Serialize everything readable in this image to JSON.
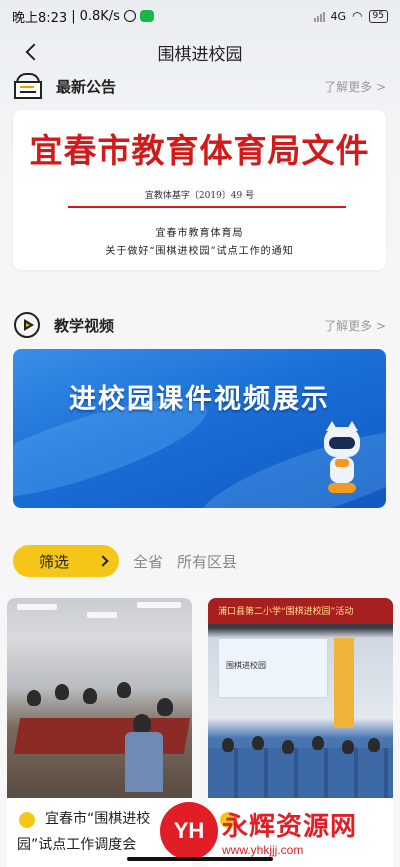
{
  "status_bar": {
    "time": "晚上8:23",
    "speed": "0.8K/s",
    "network": "4G",
    "battery": "95"
  },
  "nav": {
    "title": "围棋进校园"
  },
  "announcements": {
    "title": "最新公告",
    "more": "了解更多 >",
    "doc_header": "宜春市教育体育局文件",
    "doc_number": "宜教体基字〔2019〕49 号",
    "doc_line_1": "宜春市教育体育局",
    "doc_line_2": "关于做好“围棋进校园”试点工作的通知"
  },
  "videos": {
    "title": "教学视频",
    "more": "了解更多 >",
    "banner_text": "进校园课件视频展示"
  },
  "filter": {
    "button_label": "筛选",
    "option_province": "全省",
    "option_counties": "所有区县"
  },
  "cards": [
    {
      "title_line_1": "宜春市“围棋进校",
      "title_line_2": "园”试点工作调度会"
    },
    {
      "title_line_1": "",
      "title_line_2": "",
      "photo_banner": "浦口县第二小学“围棋进校园”活动",
      "photo_screen": "围棋进校园"
    }
  ],
  "watermark": {
    "logo": "YH",
    "name": "永辉资源网",
    "url": "www.yhkjjj.com"
  },
  "colors": {
    "accent": "#f5c518",
    "doc_red": "#d11b1b",
    "banner_blue": "#1a6fd6"
  }
}
